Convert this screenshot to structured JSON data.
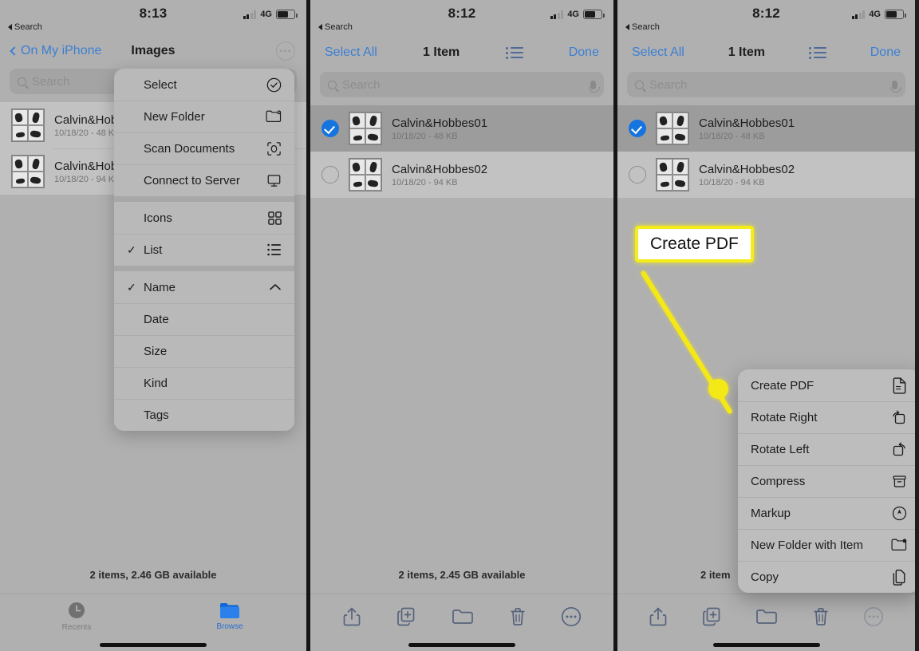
{
  "panels": [
    {
      "status": {
        "time": "8:13",
        "back_label": "Search",
        "network": "4G"
      },
      "nav": {
        "back_label": "On My iPhone",
        "title": "Images",
        "more_icon": "ellipsis-circle-icon"
      },
      "search": {
        "placeholder": "Search"
      },
      "files": [
        {
          "name": "Calvin&Hobbes01",
          "meta": "10/18/20 - 48 KB"
        },
        {
          "name": "Calvin&Hobbes02",
          "meta": "10/18/20 - 94 KB"
        }
      ],
      "status_line": "2 items, 2.46 GB available",
      "tabs": [
        {
          "label": "Recents",
          "icon": "clock-icon",
          "active": false
        },
        {
          "label": "Browse",
          "icon": "folder-icon",
          "active": true
        }
      ],
      "menu": {
        "groups": [
          [
            {
              "label": "Select",
              "icon": "check-circle-icon",
              "checked": false
            },
            {
              "label": "New Folder",
              "icon": "new-folder-icon",
              "checked": false
            },
            {
              "label": "Scan Documents",
              "icon": "scan-icon",
              "checked": false
            },
            {
              "label": "Connect to Server",
              "icon": "monitor-icon",
              "checked": false
            }
          ],
          [
            {
              "label": "Icons",
              "icon": "grid-icon",
              "checked": false
            },
            {
              "label": "List",
              "icon": "list-icon",
              "checked": true
            }
          ],
          [
            {
              "label": "Name",
              "icon": "chevron-up-icon",
              "checked": true
            },
            {
              "label": "Date",
              "icon": "",
              "checked": false
            },
            {
              "label": "Size",
              "icon": "",
              "checked": false
            },
            {
              "label": "Kind",
              "icon": "",
              "checked": false
            },
            {
              "label": "Tags",
              "icon": "",
              "checked": false
            }
          ]
        ]
      }
    },
    {
      "status": {
        "time": "8:12",
        "back_label": "Search",
        "network": "4G"
      },
      "nav": {
        "select_all": "Select All",
        "count": "1 Item",
        "done": "Done",
        "list_icon": "list-view-icon"
      },
      "search": {
        "placeholder": "Search"
      },
      "files": [
        {
          "name": "Calvin&Hobbes01",
          "meta": "10/18/20 - 48 KB",
          "selected": true
        },
        {
          "name": "Calvin&Hobbes02",
          "meta": "10/18/20 - 94 KB",
          "selected": false
        }
      ],
      "status_line": "2 items, 2.45 GB available",
      "toolbar": [
        {
          "icon": "share-icon"
        },
        {
          "icon": "duplicate-icon"
        },
        {
          "icon": "move-to-folder-icon"
        },
        {
          "icon": "trash-icon"
        },
        {
          "icon": "more-ellipsis-icon"
        }
      ]
    },
    {
      "status": {
        "time": "8:12",
        "back_label": "Search",
        "network": "4G"
      },
      "nav": {
        "select_all": "Select All",
        "count": "1 Item",
        "done": "Done",
        "list_icon": "list-view-icon"
      },
      "search": {
        "placeholder": "Search"
      },
      "files": [
        {
          "name": "Calvin&Hobbes01",
          "meta": "10/18/20 - 48 KB",
          "selected": true
        },
        {
          "name": "Calvin&Hobbes02",
          "meta": "10/18/20 - 94 KB",
          "selected": false
        }
      ],
      "status_line": "2 item",
      "toolbar": [
        {
          "icon": "share-icon"
        },
        {
          "icon": "duplicate-icon"
        },
        {
          "icon": "move-to-folder-icon"
        },
        {
          "icon": "trash-icon"
        },
        {
          "icon": "more-ellipsis-icon"
        }
      ],
      "context_menu": [
        {
          "label": "Create PDF",
          "icon": "document-icon"
        },
        {
          "label": "Rotate Right",
          "icon": "rotate-right-icon"
        },
        {
          "label": "Rotate Left",
          "icon": "rotate-left-icon"
        },
        {
          "label": "Compress",
          "icon": "archive-icon"
        },
        {
          "label": "Markup",
          "icon": "markup-pen-icon"
        },
        {
          "label": "New Folder with Item",
          "icon": "new-folder-icon"
        },
        {
          "label": "Copy",
          "icon": "copy-icon"
        }
      ]
    }
  ],
  "callout": {
    "label": "Create PDF",
    "color": "#f5e817"
  },
  "colors": {
    "accent_blue": "#3b7fd4",
    "selected_blue": "#1574e0",
    "highlight_yellow": "#f5e817"
  }
}
